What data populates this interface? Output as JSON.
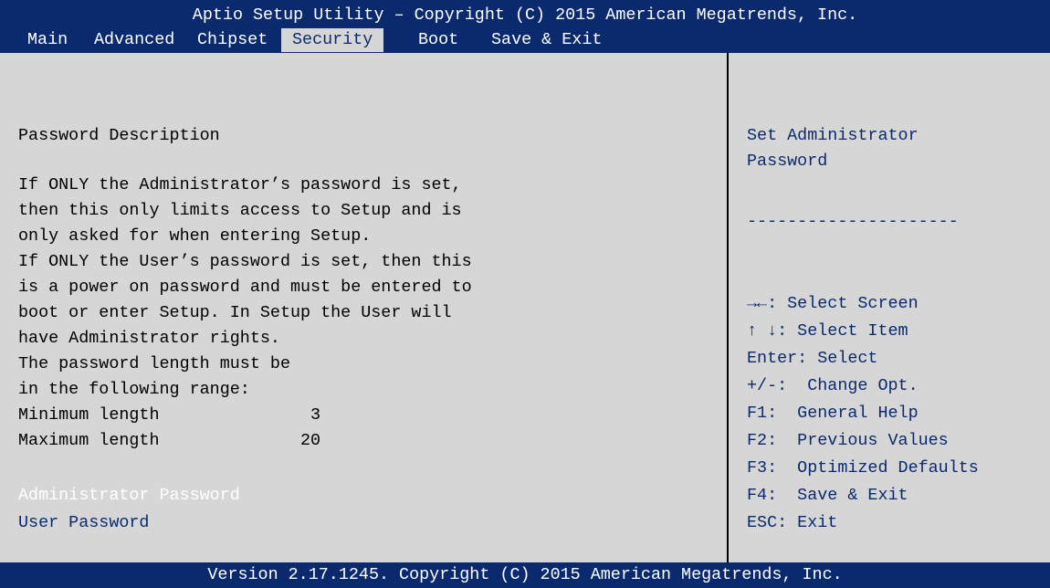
{
  "header": {
    "title": "Aptio Setup Utility – Copyright (C) 2015 American Megatrends, Inc.",
    "tabs": [
      {
        "label": "Main"
      },
      {
        "label": "Advanced"
      },
      {
        "label": "Chipset"
      },
      {
        "label": "Security"
      },
      {
        "label": "Boot"
      },
      {
        "label": "Save & Exit"
      }
    ],
    "active_tab": "Security"
  },
  "main": {
    "section_title": "Password Description",
    "description_lines": [
      "If ONLY the Administrator’s password is set,",
      "then this only limits access to Setup and is",
      "only asked for when entering Setup.",
      "If ONLY the User’s password is set, then this",
      "is a power on password and must be entered to",
      "boot or enter Setup. In Setup the User will",
      "have Administrator rights.",
      "The password length must be",
      "in the following range:"
    ],
    "min_length": {
      "label": "Minimum length",
      "value": "3"
    },
    "max_length": {
      "label": "Maximum length",
      "value": "20"
    },
    "items": [
      {
        "label": "Administrator Password"
      },
      {
        "label": "User Password"
      }
    ]
  },
  "help": {
    "description_lines": [
      "Set Administrator",
      "Password"
    ],
    "separator": "---------------------",
    "keys": [
      "→←: Select Screen",
      "↑ ↓: Select Item",
      "Enter: Select",
      "+/-:  Change Opt.",
      "F1:  General Help",
      "F2:  Previous Values",
      "F3:  Optimized Defaults",
      "F4:  Save & Exit",
      "ESC: Exit"
    ]
  },
  "footer": {
    "text": "Version 2.17.1245. Copyright (C) 2015 American Megatrends, Inc."
  },
  "colors": {
    "header_bg": "#0b2a6e",
    "panel_bg": "#d6d6d6",
    "highlight_text": "#0b2a6e",
    "selected_item_text": "#ffffff"
  }
}
